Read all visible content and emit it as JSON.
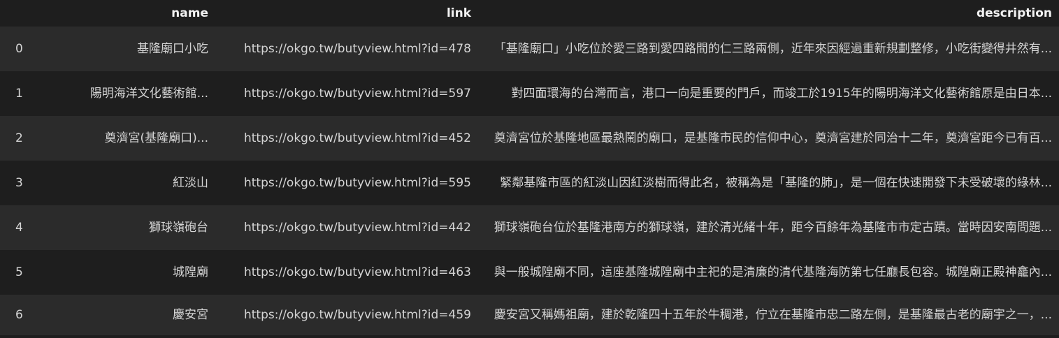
{
  "columns": {
    "index": "",
    "name": "name",
    "link": "link",
    "description": "description"
  },
  "rows": [
    {
      "index": "0",
      "name": "基隆廟口小吃",
      "link": "https://okgo.tw/butyview.html?id=478",
      "description": "「基隆廟口」小吃位於愛三路到愛四路間的仁三路兩側，近年來因經過重新規劃整修，小吃街變得井然有..."
    },
    {
      "index": "1",
      "name": "陽明海洋文化藝術館...",
      "link": "https://okgo.tw/butyview.html?id=597",
      "description": "對四面環海的台灣而言，港口一向是重要的門戶，而竣工於1915年的陽明海洋文化藝術館原是由日本..."
    },
    {
      "index": "2",
      "name": "奠濟宮(基隆廟口)...",
      "link": "https://okgo.tw/butyview.html?id=452",
      "description": "奠濟宮位於基隆地區最熱鬧的廟口，是基隆市民的信仰中心，奠濟宮建於同治十二年，奠濟宮距今已有百..."
    },
    {
      "index": "3",
      "name": "紅淡山",
      "link": "https://okgo.tw/butyview.html?id=595",
      "description": "緊鄰基隆市區的紅淡山因紅淡樹而得此名，被稱為是「基隆的肺」，是一個在快速開發下未受破壞的綠林..."
    },
    {
      "index": "4",
      "name": "獅球嶺砲台",
      "link": "https://okgo.tw/butyview.html?id=442",
      "description": "獅球嶺砲台位於基隆港南方的獅球嶺，建於清光緒十年，距今百餘年為基隆市市定古蹟。當時因安南問題..."
    },
    {
      "index": "5",
      "name": "城隍廟",
      "link": "https://okgo.tw/butyview.html?id=463",
      "description": "與一般城隍廟不同，這座基隆城隍廟中主祀的是清廉的清代基隆海防第七任廳長包容。城隍廟正殿神龕內..."
    },
    {
      "index": "6",
      "name": "慶安宮",
      "link": "https://okgo.tw/butyview.html?id=459",
      "description": "慶安宮又稱媽祖廟，建於乾隆四十五年於牛稠港，佇立在基隆市忠二路左側，是基隆最古老的廟宇之一，..."
    }
  ]
}
